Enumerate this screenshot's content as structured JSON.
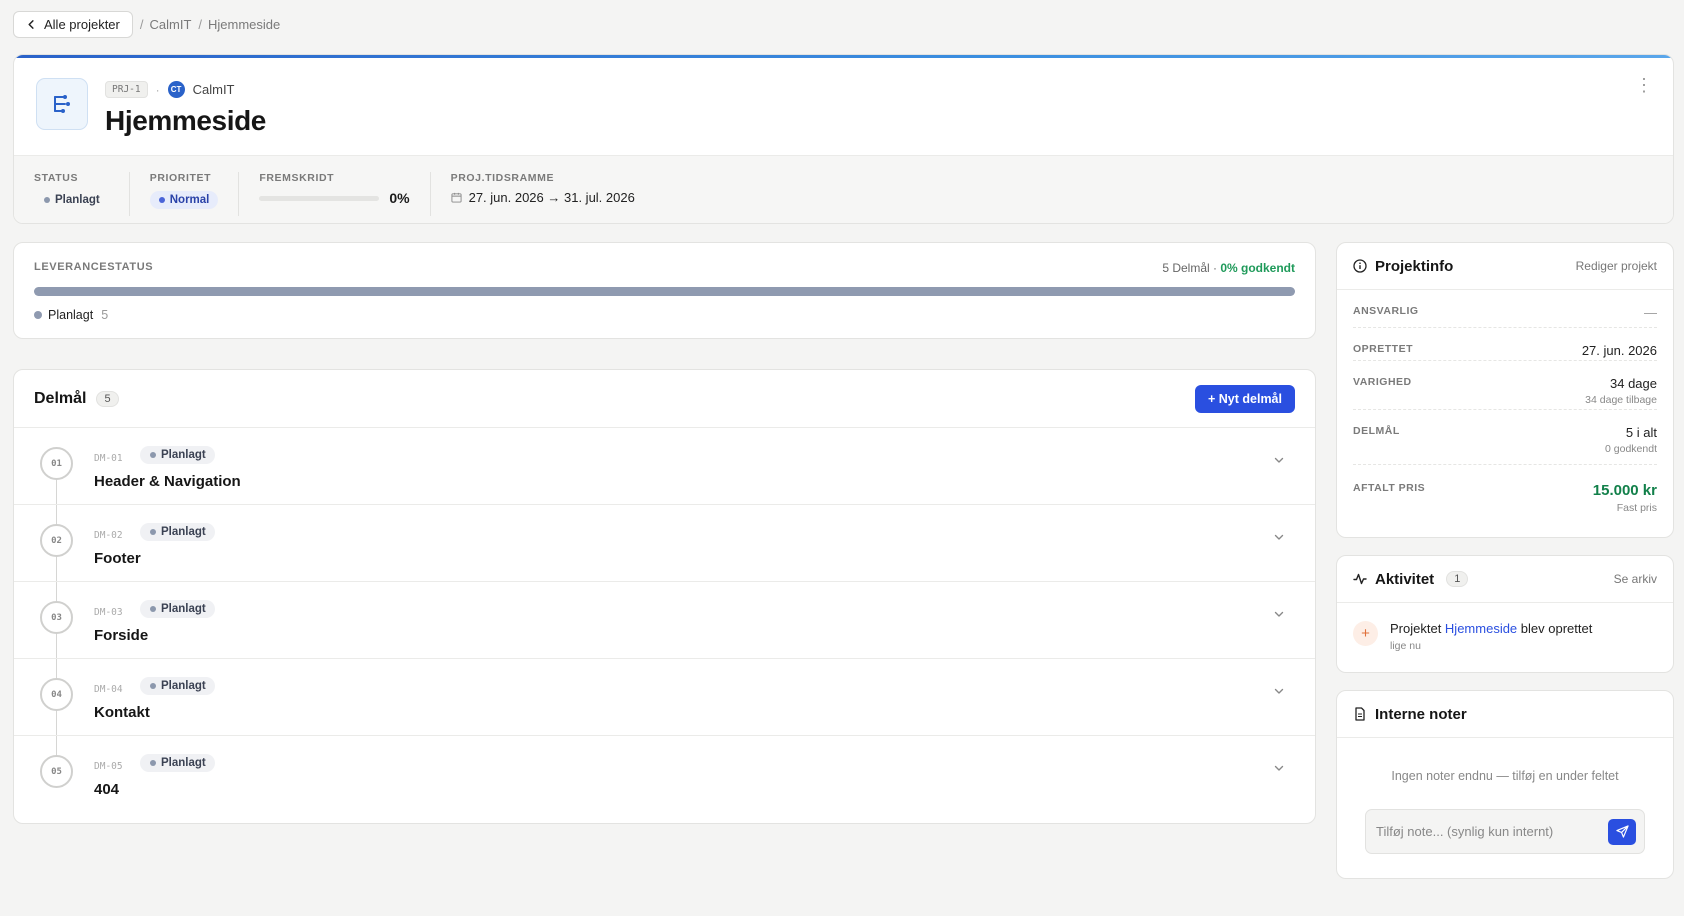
{
  "nav": {
    "back_label": "Alle projekter",
    "crumbs": [
      "CalmIT",
      "Hjemmeside"
    ]
  },
  "project": {
    "code": "PRJ-1",
    "client_initials": "CT",
    "client": "CalmIT",
    "title": "Hjemmeside"
  },
  "stats": {
    "status_label": "STATUS",
    "status": "Planlagt",
    "priority_label": "PRIORITET",
    "priority": "Normal",
    "progress_label": "FREMSKRIDT",
    "progress": "0%",
    "progress_fraction": 0,
    "timeframe_label": "PROJ.TIDSRAMME",
    "timeframe": "27. jun. 2026 → 31. jul. 2026"
  },
  "delivery": {
    "label": "LEVERANCESTATUS",
    "summary": "5 Delmål · ",
    "approved": "0% godkendt",
    "legend_label": "Planlagt",
    "legend_count": "5",
    "bar_color": "#8f9ab0"
  },
  "milestones": {
    "title": "Delmål",
    "count": "5",
    "new_button": "+ Nyt delmål",
    "items": [
      {
        "step": "01",
        "code": "DM-01",
        "status": "Planlagt",
        "name": "Header & Navigation"
      },
      {
        "step": "02",
        "code": "DM-02",
        "status": "Planlagt",
        "name": "Footer"
      },
      {
        "step": "03",
        "code": "DM-03",
        "status": "Planlagt",
        "name": "Forside"
      },
      {
        "step": "04",
        "code": "DM-04",
        "status": "Planlagt",
        "name": "Kontakt"
      },
      {
        "step": "05",
        "code": "DM-05",
        "status": "Planlagt",
        "name": "404"
      }
    ]
  },
  "info": {
    "title": "Projektinfo",
    "edit_link": "Rediger projekt",
    "responsible_label": "ANSVARLIG",
    "responsible": "—",
    "created_label": "OPRETTET",
    "created": "27. jun. 2026",
    "duration_label": "VARIGHED",
    "duration": "34 dage",
    "duration_sub": "34 dage tilbage",
    "milestones_label": "DELMÅL",
    "milestones_total": "5 i alt",
    "milestones_sub": "0 godkendt",
    "price_label": "AFTALT PRIS",
    "price": "15.000 kr",
    "price_sub": "Fast pris"
  },
  "activity": {
    "title": "Aktivitet",
    "count": "1",
    "archive_link": "Se arkiv",
    "entry_prefix": "Projektet ",
    "entry_link": "Hjemmeside",
    "entry_suffix": " blev oprettet",
    "entry_time": "lige nu"
  },
  "notes": {
    "title": "Interne noter",
    "empty": "Ingen noter endnu — tilføj en under feltet",
    "placeholder": "Tilføj note... (synlig kun internt)"
  },
  "colors": {
    "accent": "#2a4fe0",
    "brand": "#2a62c9",
    "success": "#12804a"
  }
}
